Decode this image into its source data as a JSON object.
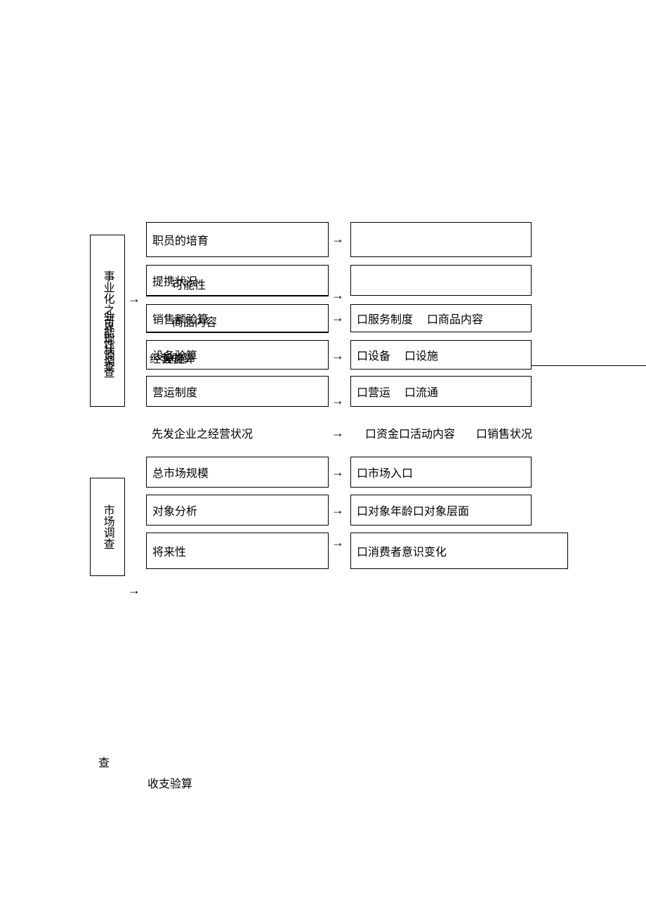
{
  "left1": "事业化之可能性调查",
  "left1b": "业界现状调查",
  "left2": "市场调查",
  "left3_char": "查",
  "rows": {
    "r1": "职员的培育",
    "r2a": "提携状况",
    "r2b": "可能性",
    "r3a": "销售额验算",
    "r3b": "商品内容",
    "r4a": "设备验算",
    "r4b": "设施",
    "r4c": "经营验算",
    "r5": "营运制度",
    "r6": "先发企业之经营状况",
    "r7": "总市场规模",
    "r8": "对象分析",
    "r9": "将来性"
  },
  "right": {
    "r3": [
      "口服务制度",
      "口商品内容"
    ],
    "r4": [
      "口设备",
      "口设施"
    ],
    "r5": [
      "口营运",
      "口流通"
    ],
    "r6": [
      "口资金口活动内容",
      "口销售状况"
    ],
    "r7": [
      "口市场入口"
    ],
    "r8": [
      "口对象年龄口对象层面"
    ],
    "r9": [
      "口消费者意识变化"
    ]
  },
  "bottom": "收支验算",
  "arrow": "→"
}
